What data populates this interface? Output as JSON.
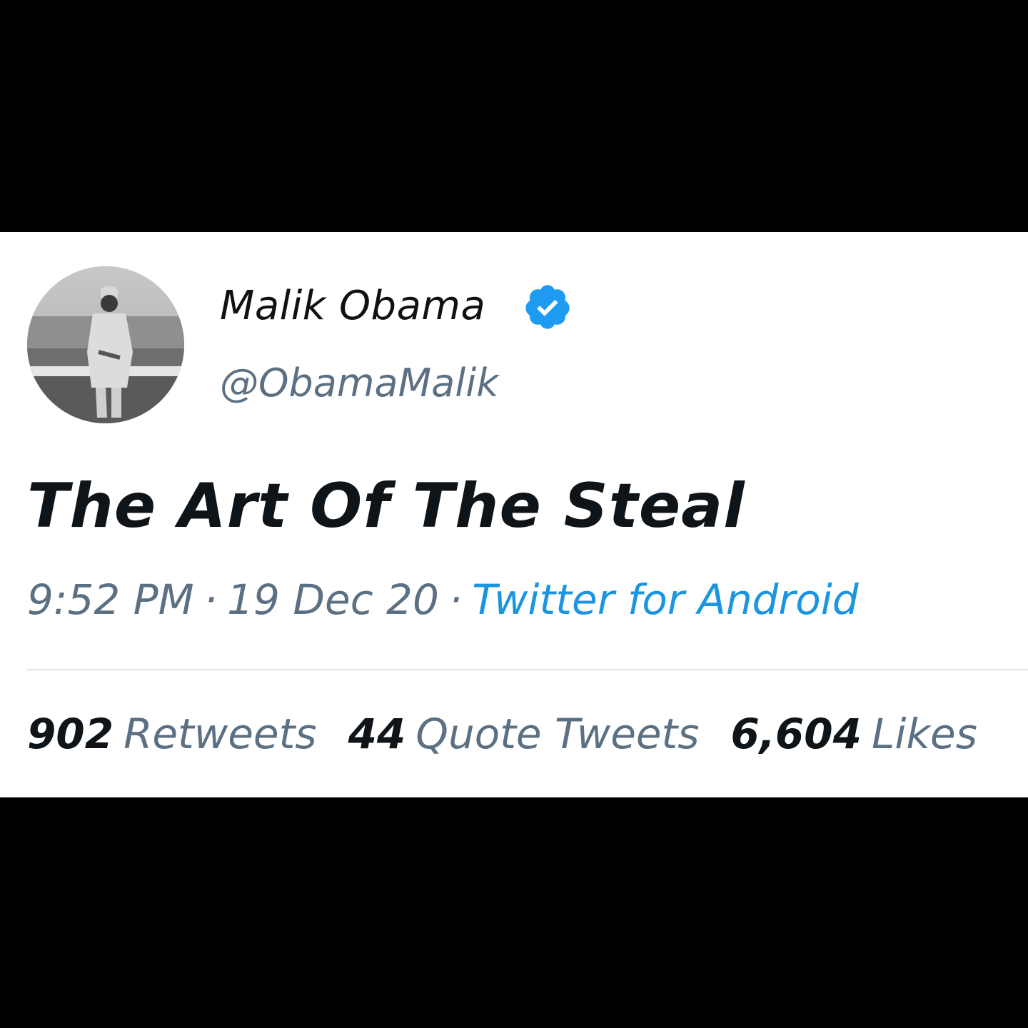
{
  "user": {
    "display_name": "Malik Obama",
    "handle": "@ObamaMalik",
    "verified": true
  },
  "tweet": {
    "text": "The Art Of The Steal",
    "time": "9:52 PM",
    "date": "19 Dec 20",
    "source": "Twitter for Android",
    "separator": "·"
  },
  "stats": {
    "retweets_count": "902",
    "retweets_label": "Retweets",
    "quotes_count": "44",
    "quotes_label": "Quote Tweets",
    "likes_count": "6,604",
    "likes_label": "Likes"
  },
  "colors": {
    "background": "#000000",
    "card": "#ffffff",
    "text_primary": "#0f1419",
    "text_secondary": "#5b7083",
    "link": "#1b95e0",
    "verified": "#1d9bf0"
  },
  "icons": {
    "verified": "verified-badge-icon",
    "avatar": "profile-photo"
  }
}
